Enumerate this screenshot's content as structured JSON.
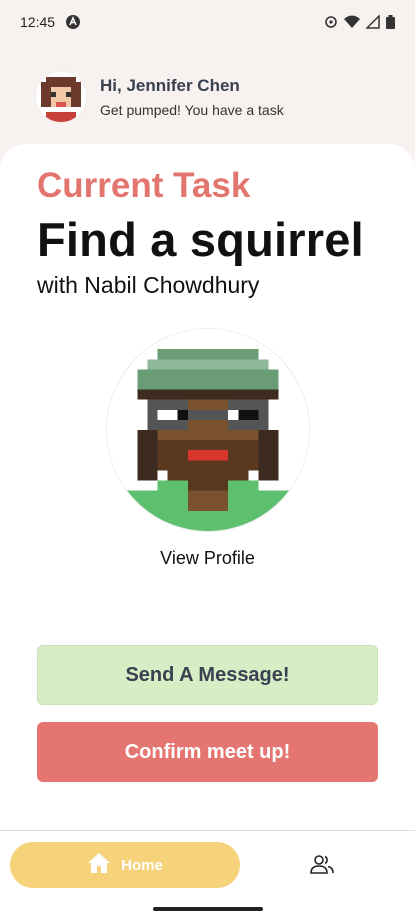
{
  "status": {
    "time": "12:45"
  },
  "header": {
    "greeting": "Hi, Jennifer Chen",
    "subtitle": "Get pumped! You have a task"
  },
  "task": {
    "eyebrow": "Current Task",
    "title": "Find a squirrel",
    "partner": "with Nabil Chowdhury",
    "view_profile": "View Profile"
  },
  "actions": {
    "message": "Send A Message!",
    "confirm": "Confirm meet up!"
  },
  "nav": {
    "home_label": "Home",
    "home_icon": "home-icon",
    "friends_icon": "people-icon"
  },
  "colors": {
    "accent_red": "#e2766f",
    "message_green": "#d6edc5",
    "nav_yellow": "#f6d27a"
  }
}
